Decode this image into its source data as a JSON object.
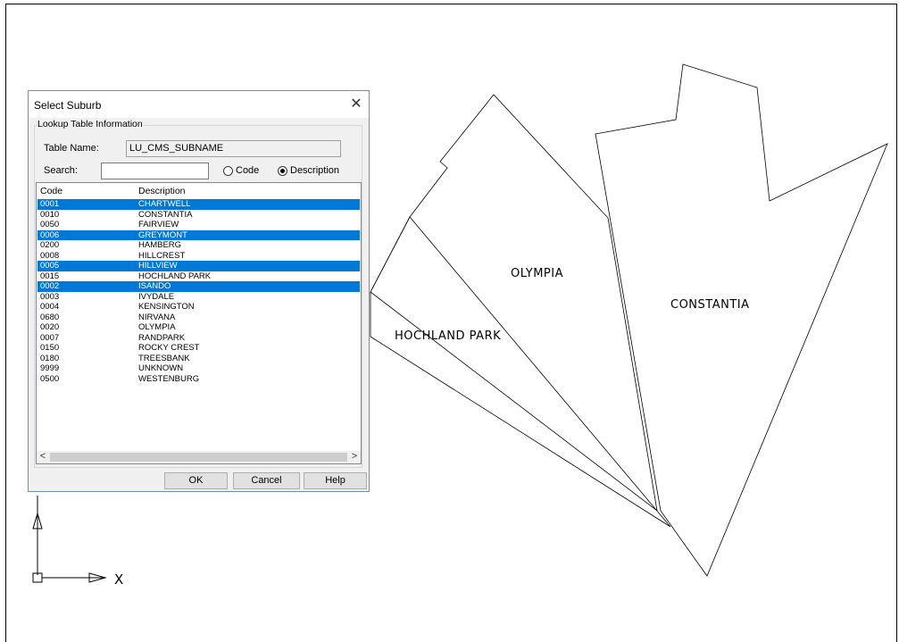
{
  "drawing": {
    "parcels": [
      "OLYMPIA",
      "CONSTANTIA",
      "HOCHLAND PARK"
    ],
    "ucs_axis": "X"
  },
  "dialog": {
    "title": "Select Suburb",
    "close_glyph": "✕",
    "group_label": "Lookup Table Information",
    "table_name_label": "Table Name:",
    "table_name_value": "LU_CMS_SUBNAME",
    "search_label": "Search:",
    "search_value": "",
    "radio_code": "Code",
    "radio_description": "Description",
    "selected_radio": "Description",
    "columns": [
      "Code",
      "Description"
    ],
    "rows": [
      {
        "code": "0001",
        "description": "CHARTWELL",
        "selected": true
      },
      {
        "code": "0010",
        "description": "CONSTANTIA",
        "selected": false
      },
      {
        "code": "0050",
        "description": "FAIRVIEW",
        "selected": false
      },
      {
        "code": "0006",
        "description": "GREYMONT",
        "selected": true
      },
      {
        "code": "0200",
        "description": "HAMBERG",
        "selected": false
      },
      {
        "code": "0008",
        "description": "HILLCREST",
        "selected": false
      },
      {
        "code": "0005",
        "description": "HILLVIEW",
        "selected": true
      },
      {
        "code": "0015",
        "description": "HOCHLAND PARK",
        "selected": false
      },
      {
        "code": "0002",
        "description": "ISANDO",
        "selected": true
      },
      {
        "code": "0003",
        "description": "IVYDALE",
        "selected": false
      },
      {
        "code": "0004",
        "description": "KENSINGTON",
        "selected": false
      },
      {
        "code": "0680",
        "description": "NIRVANA",
        "selected": false
      },
      {
        "code": "0020",
        "description": "OLYMPIA",
        "selected": false
      },
      {
        "code": "0007",
        "description": "RANDPARK",
        "selected": false
      },
      {
        "code": "0150",
        "description": "ROCKY CREST",
        "selected": false
      },
      {
        "code": "0180",
        "description": "TREESBANK",
        "selected": false
      },
      {
        "code": "9999",
        "description": "UNKNOWN",
        "selected": false
      },
      {
        "code": "0500",
        "description": "WESTENBURG",
        "selected": false
      }
    ],
    "scroll_left": "<",
    "scroll_right": ">",
    "ok_label": "OK",
    "cancel_label": "Cancel",
    "help_label": "Help"
  },
  "colors": {
    "selection": "#0078d7",
    "dialog_bg": "#f0f0f0",
    "button_bg": "#e1e1e1"
  }
}
